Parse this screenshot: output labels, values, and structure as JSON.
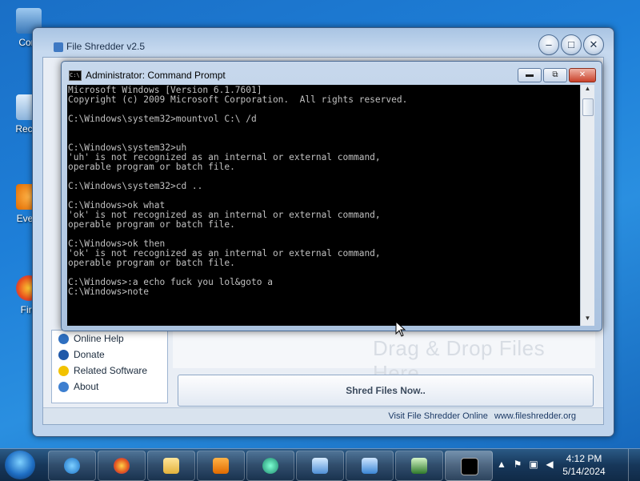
{
  "desktop": {
    "icons": [
      {
        "label": "Com"
      },
      {
        "label": "Recyc"
      },
      {
        "label": "Every"
      },
      {
        "label": "Fire"
      }
    ]
  },
  "shredder": {
    "title": "File Shredder v2.5",
    "side_items": [
      {
        "label": "Online Help",
        "icon": "help-icon"
      },
      {
        "label": "Donate",
        "icon": "paypal-icon"
      },
      {
        "label": "Related Software",
        "icon": "star-icon"
      },
      {
        "label": "About",
        "icon": "info-icon"
      }
    ],
    "dropzone_text": "Drag & Drop Files Here",
    "shred_button": "Shred Files Now..",
    "footer_visit": "Visit File Shredder Online",
    "footer_url": "www.fileshredder.org"
  },
  "cmd": {
    "title": "Administrator: Command Prompt",
    "icon_text": "C:\\",
    "output": "Microsoft Windows [Version 6.1.7601]\nCopyright (c) 2009 Microsoft Corporation.  All rights reserved.\n\nC:\\Windows\\system32>mountvol C:\\ /d\n\n\nC:\\Windows\\system32>uh\n'uh' is not recognized as an internal or external command,\noperable program or batch file.\n\nC:\\Windows\\system32>cd ..\n\nC:\\Windows>ok what\n'ok' is not recognized as an internal or external command,\noperable program or batch file.\n\nC:\\Windows>ok then\n'ok' is not recognized as an internal or external command,\noperable program or batch file.\n\nC:\\Windows>:a echo fuck you lol&goto a\nC:\\Windows>note"
  },
  "taskbar": {
    "items": [
      "internet-explorer",
      "firefox",
      "file-explorer",
      "media-player",
      "app-green-circle",
      "control-panel",
      "recycle-bin",
      "task-manager",
      "command-prompt"
    ],
    "time": "4:12 PM",
    "date": "5/14/2024"
  },
  "colors": {
    "desktop": "#1e7fd8",
    "console_bg": "#000000",
    "console_fg": "#c0c0c0",
    "taskbar": "#17375a"
  }
}
